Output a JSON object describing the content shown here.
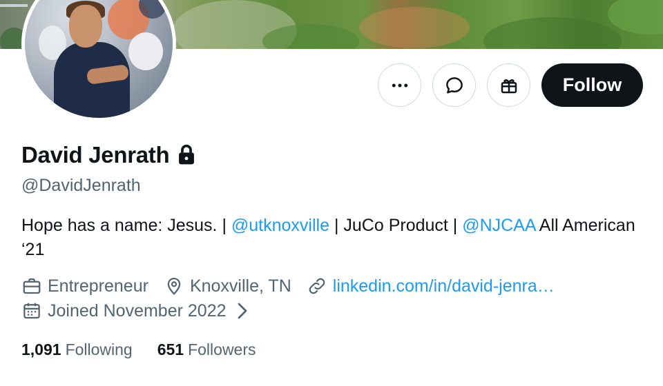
{
  "profile": {
    "display_name": "David Jenrath",
    "handle": "@DavidJenrath",
    "bio": {
      "part1": "Hope has a name: Jesus. | ",
      "mention1": "@utknoxville",
      "part2": " | JuCo Product | ",
      "mention2": "@NJCAA",
      "part3": " All American ‘21"
    },
    "category": "Entrepreneur",
    "location": "Knoxville, TN",
    "website": "linkedin.com/in/david-jenra…",
    "joined": "Joined November 2022"
  },
  "actions": {
    "follow_label": "Follow",
    "more_icon": "more-icon",
    "message_icon": "message-icon",
    "gift_icon": "gift-icon"
  },
  "stats": {
    "following_count": "1,091",
    "following_label": "Following",
    "followers_count": "651",
    "followers_label": "Followers"
  },
  "colors": {
    "text_primary": "#0f1419",
    "text_secondary": "#536471",
    "link": "#1d9bf0",
    "follow_bg": "#0f1419",
    "border": "#cfd9de"
  }
}
